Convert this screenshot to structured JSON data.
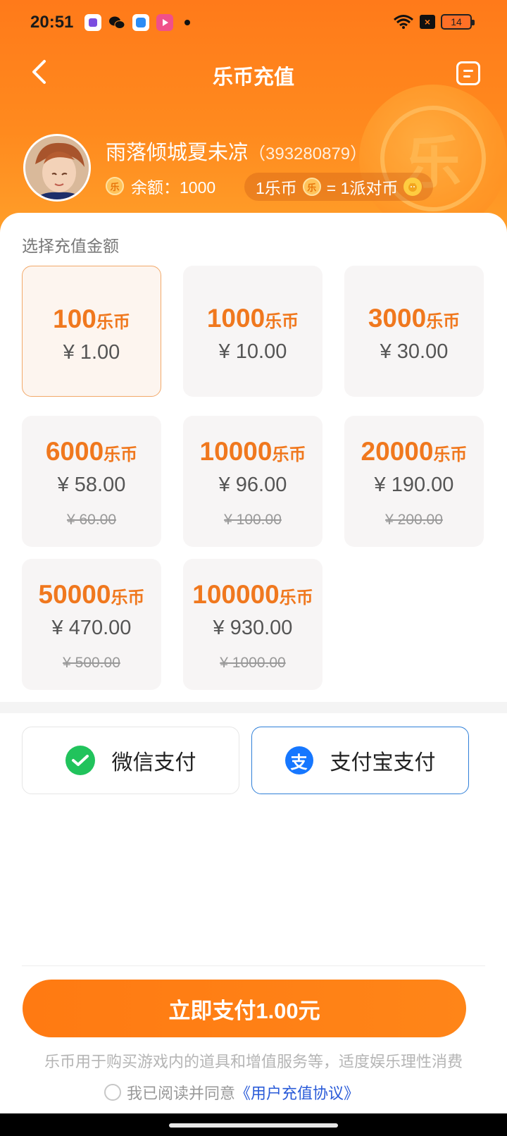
{
  "status_bar": {
    "time": "20:51",
    "battery": "14"
  },
  "header": {
    "title": "乐币充值"
  },
  "user": {
    "name": "雨落倾城夏未凉",
    "uid": "（393280879）",
    "balance": "余额：1000",
    "rate_left": "1乐币",
    "rate_right": "= 1派对币",
    "coin_glyph": "乐"
  },
  "section_label": "选择充值金额",
  "packages": [
    {
      "coins": "100",
      "unit": "乐币",
      "price": "¥ 1.00",
      "original": ""
    },
    {
      "coins": "1000",
      "unit": "乐币",
      "price": "¥ 10.00",
      "original": ""
    },
    {
      "coins": "3000",
      "unit": "乐币",
      "price": "¥ 30.00",
      "original": ""
    },
    {
      "coins": "6000",
      "unit": "乐币",
      "price": "¥ 58.00",
      "original": "¥ 60.00"
    },
    {
      "coins": "10000",
      "unit": "乐币",
      "price": "¥ 96.00",
      "original": "¥ 100.00"
    },
    {
      "coins": "20000",
      "unit": "乐币",
      "price": "¥ 190.00",
      "original": "¥ 200.00"
    },
    {
      "coins": "50000",
      "unit": "乐币",
      "price": "¥ 470.00",
      "original": "¥ 500.00"
    },
    {
      "coins": "100000",
      "unit": "乐币",
      "price": "¥ 930.00",
      "original": "¥ 1000.00"
    }
  ],
  "selected_package": 0,
  "payment": {
    "wechat_label": "微信支付",
    "alipay_label": "支付宝支付",
    "selected": "alipay"
  },
  "footer": {
    "pay_button": "立即支付1.00元",
    "notice": "乐币用于购买游戏内的道具和增值服务等，适度娱乐理性消费",
    "agree_text": "我已阅读并同意",
    "agreement_link": "《用户充值协议》"
  },
  "colors": {
    "accent": "#ff7a12",
    "coin_text": "#f0781e",
    "alipay_blue": "#1677ff",
    "wechat_green": "#21c35c"
  }
}
